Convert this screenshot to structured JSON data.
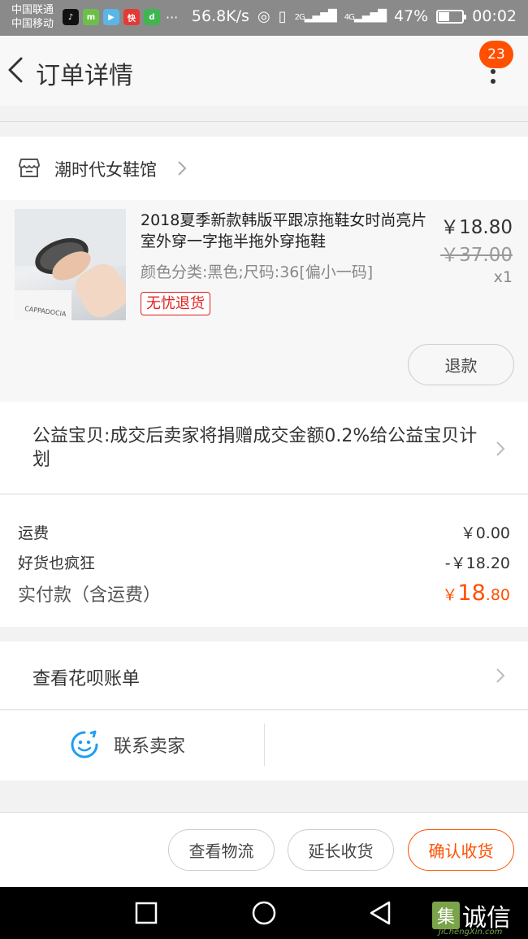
{
  "status_bar": {
    "carrier_1": "中国联通",
    "carrier_2": "中国移动",
    "app_icons": [
      "tiktok-icon",
      "m-app-icon",
      "video-app-icon",
      "news-app-icon",
      "du-app-icon"
    ],
    "more": "···",
    "network_speed": "56.8K/s",
    "signal_2g": "2G",
    "signal_4g": "4G",
    "battery_text": "47%",
    "battery_level": 0.47,
    "time": "00:02"
  },
  "header": {
    "title": "订单详情",
    "badge": "23"
  },
  "shop": {
    "name": "潮时代女鞋馆"
  },
  "product": {
    "title": "2018夏季新款韩版平跟凉拖鞋女时尚亮片室外穿一字拖半拖外穿拖鞋",
    "sku": "颜色分类:黑色;尺码:36[偏小一码]",
    "tag": "无忧退货",
    "price": "￥18.80",
    "original_price": "￥37.00",
    "quantity": "x1",
    "image_text": "CAPPADOCIA",
    "refund_label": "退款"
  },
  "charity": {
    "text": "公益宝贝:成交后卖家将捐赠成交金额0.2%给公益宝贝计划"
  },
  "fees": {
    "shipping_label": "运费",
    "shipping_value": "￥0.00",
    "discount_label": "好货也疯狂",
    "discount_value": "-￥18.20",
    "paid_label": "实付款（含运费）",
    "paid_currency": "￥",
    "paid_int": "18",
    "paid_dec": ".80"
  },
  "huabei": {
    "label": "查看花呗账单"
  },
  "contact": {
    "label": "联系卖家"
  },
  "actions": {
    "logistics": "查看物流",
    "extend": "延长收货",
    "confirm": "确认收货"
  },
  "watermark": {
    "mark": "集",
    "text": "诚信",
    "sub": "JiChengXin.com"
  },
  "colors": {
    "accent": "#ff5000",
    "tag_red": "#e02020",
    "status_bar": "#8a8a8a"
  }
}
